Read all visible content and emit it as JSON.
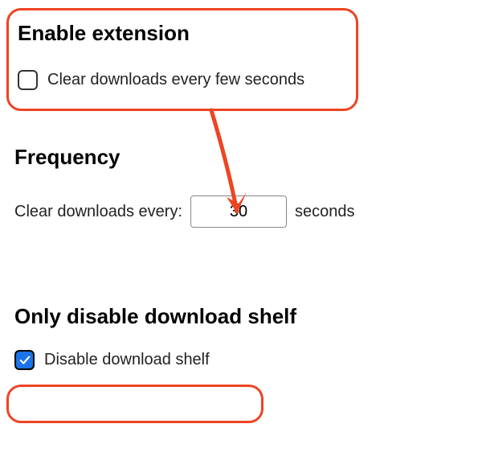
{
  "enable": {
    "title": "Enable extension",
    "checkbox_label": "Clear downloads every few seconds",
    "checked": false
  },
  "frequency": {
    "title": "Frequency",
    "prefix_label": "Clear downloads every:",
    "value": "30",
    "suffix_label": "seconds"
  },
  "shelf": {
    "title": "Only disable download shelf",
    "checkbox_label": "Disable download shelf",
    "checked": true
  },
  "annotation": {
    "color": "#ee4422"
  }
}
